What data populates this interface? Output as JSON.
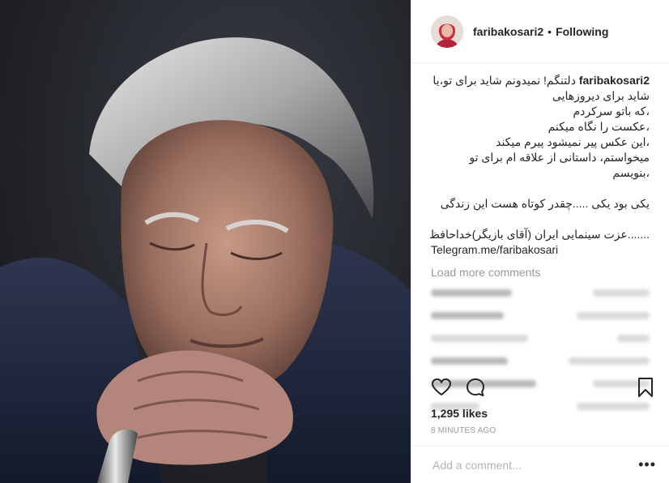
{
  "post": {
    "image_alt": "",
    "header": {
      "username": "faribakosari2",
      "separator": "•",
      "follow_status": "Following"
    },
    "caption": {
      "username": "faribakosari2",
      "first_line": "دلتنگم! نمیدونم شاید برای تو،یا",
      "lines": [
        "شاید برای دیروزهایی",
        "،که باتو سرکردم",
        "،عکست را نگاه میکنم",
        "،این عکس پیر نمیشود پیرم میکند",
        "میخواستم، داستانی از علاقه ام برای تو",
        "،بنویسم",
        "",
        "یکی بود یکی .....چقدر کوتاه هست این زندگی",
        "",
        ".......عزت سینمایی ایران (آقای بازیگر)خداحافظ"
      ],
      "link": "Telegram.me/faribakosari"
    },
    "load_more": "Load more comments",
    "likes": "1,295 likes",
    "timestamp": "8 MINUTES AGO",
    "add_comment_placeholder": "Add a comment...",
    "more_options": "•••",
    "icons": [
      "heart-icon",
      "comment-icon",
      "bookmark-icon",
      "more-options-icon"
    ],
    "colors": {
      "text": "#262626",
      "muted": "#999999",
      "border": "#efefef"
    }
  }
}
